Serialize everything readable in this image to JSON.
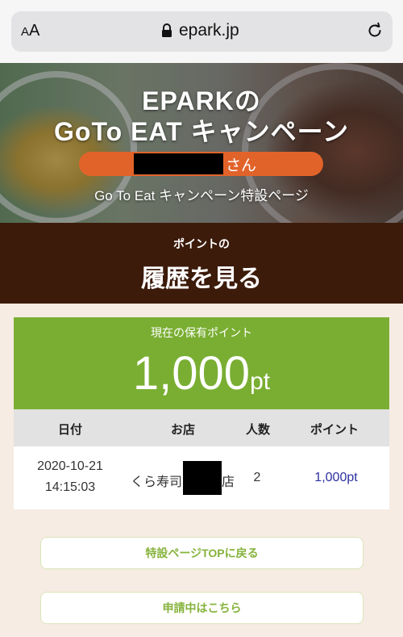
{
  "browser": {
    "aa_label_small": "A",
    "aa_label_large": "A",
    "url": "epark.jp"
  },
  "banner": {
    "title_line1": "EPARKの",
    "title_line2": "GoTo EAT キャンペーン",
    "name_suffix": "さん",
    "subtitle": "Go To Eat キャンペーン特設ページ"
  },
  "header": {
    "small": "ポイントの",
    "large": "履歴を見る"
  },
  "points": {
    "label": "現在の保有ポイント",
    "value": "1,000",
    "unit": "pt"
  },
  "table": {
    "headers": [
      "日付",
      "お店",
      "人数",
      "ポイント"
    ],
    "rows": [
      {
        "date": "2020-10-21",
        "time": "14:15:03",
        "store_prefix": "くら寿司",
        "store_suffix": "店",
        "people": "2",
        "points": "1,000pt"
      }
    ]
  },
  "buttons": {
    "top": "特設ページTOPに戻る",
    "pending": "申請中はこちら"
  },
  "colors": {
    "accent_green": "#7aae32",
    "header_brown": "#3c1b0b",
    "name_orange": "#e2632a",
    "points_link": "#2b2fa0"
  }
}
